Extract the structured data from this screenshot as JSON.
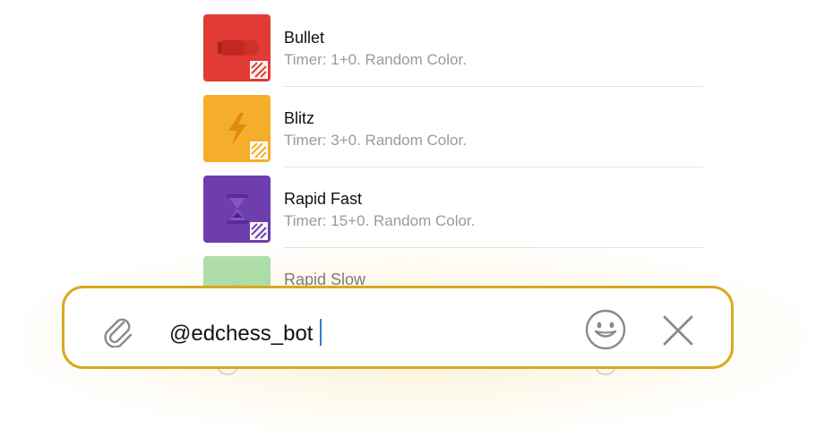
{
  "results": [
    {
      "title": "Bullet",
      "subtitle": "Timer: 1+0. Random Color.",
      "color": "#e23a34",
      "icon": "bullet-icon"
    },
    {
      "title": "Blitz",
      "subtitle": "Timer: 3+0. Random Color.",
      "color": "#f5ad2c",
      "icon": "lightning-icon"
    },
    {
      "title": "Rapid Fast",
      "subtitle": "Timer: 15+0. Random Color.",
      "color": "#6e3dae",
      "icon": "hourglass-icon"
    },
    {
      "title": "Rapid Slow",
      "subtitle": "",
      "color": "#6cc46a",
      "icon": "turtle-icon"
    }
  ],
  "input": {
    "value": "@edchess_bot",
    "border_color": "#d8a920",
    "attach_icon": "paperclip-icon",
    "emoji_icon": "smiley-icon",
    "clear_icon": "close-icon"
  }
}
